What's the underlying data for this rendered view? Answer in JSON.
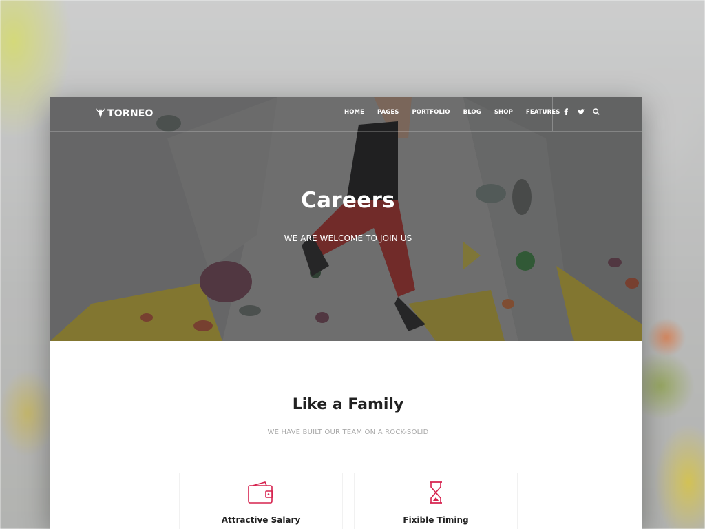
{
  "brand": {
    "name": "TORNEO",
    "accent_color": "#d6234f"
  },
  "nav": {
    "menu": [
      {
        "label": "HOME"
      },
      {
        "label": "PAGES"
      },
      {
        "label": "PORTFOLIO"
      },
      {
        "label": "BLOG"
      },
      {
        "label": "SHOP"
      },
      {
        "label": "FEATURES"
      }
    ],
    "icons": [
      "facebook-icon",
      "twitter-icon",
      "search-icon"
    ]
  },
  "hero": {
    "title": "Careers",
    "subtitle": "WE ARE WELCOME TO JOIN US"
  },
  "section": {
    "title": "Like a Family",
    "subtitle": "WE HAVE BUILT OUR TEAM ON A ROCK-SOLID"
  },
  "features": [
    {
      "icon": "wallet-icon",
      "label": "Attractive Salary"
    },
    {
      "icon": "hourglass-icon",
      "label": "Fixible Timing"
    }
  ]
}
